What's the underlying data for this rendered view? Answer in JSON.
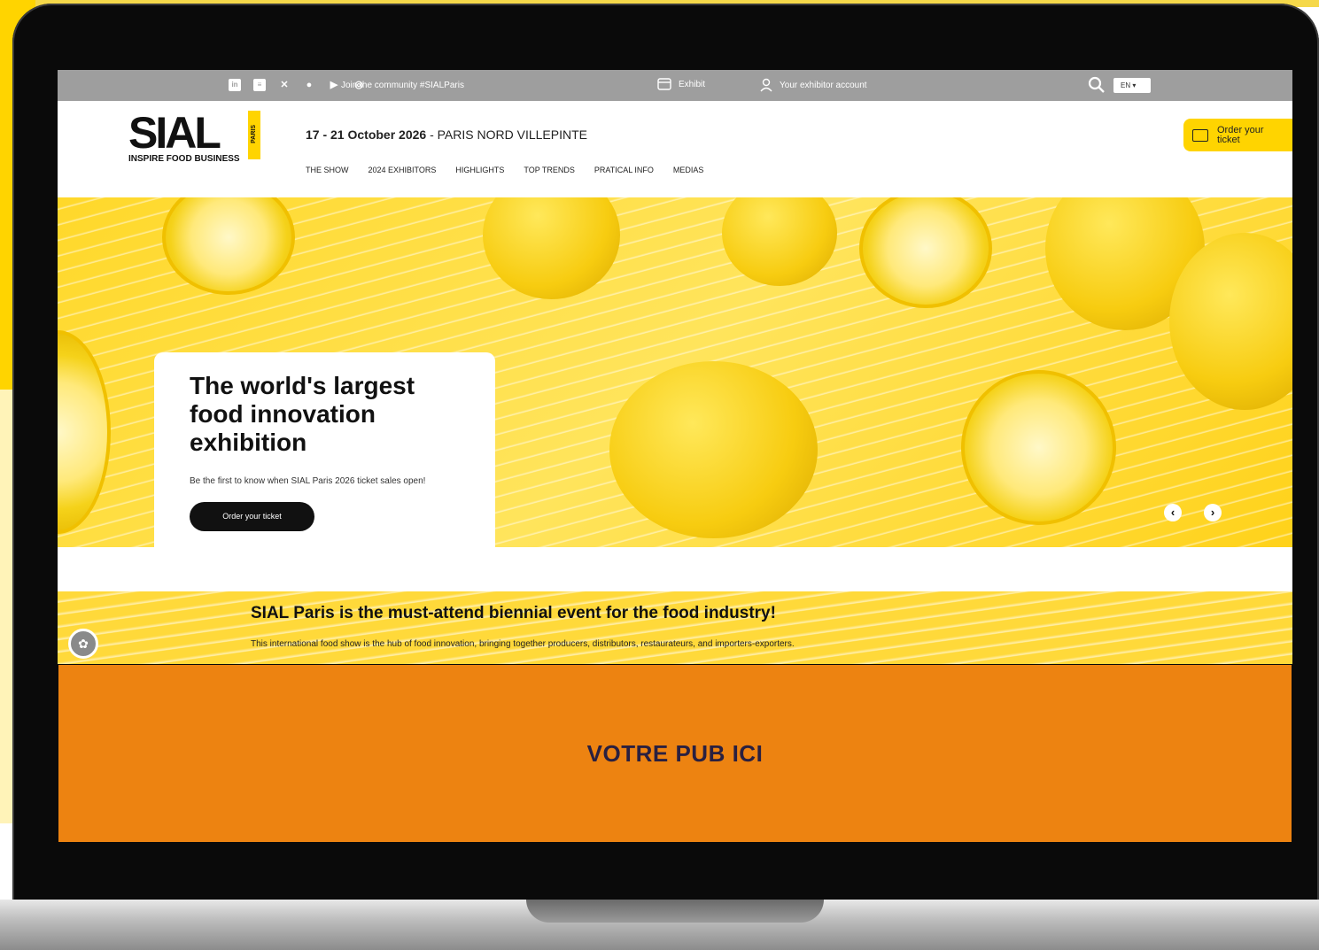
{
  "topbar": {
    "social_icons": [
      "linkedin-icon",
      "news-icon",
      "x-icon",
      "facebook-icon",
      "youtube-icon",
      "whatsapp-icon"
    ],
    "community": "Join the community #SIALParis",
    "exhibit": "Exhibit",
    "account": "Your exhibitor account",
    "lang": "EN"
  },
  "header": {
    "logo": "SIAL",
    "logo_city": "PARIS",
    "tagline": "INSPIRE FOOD BUSINESS",
    "dates": "17 - 21 October 2026",
    "venue": " - PARIS NORD VILLEPINTE",
    "nav": [
      "THE SHOW",
      "2024 EXHIBITORS",
      "HIGHLIGHTS",
      "TOP TRENDS",
      "PRATICAL INFO",
      "MEDIAS"
    ],
    "order_tab": "Order your ticket"
  },
  "hero": {
    "title": "The world's largest food innovation exhibition",
    "subtitle": "Be the first to know when SIAL Paris 2026 ticket sales open!",
    "button": "Order your ticket"
  },
  "banner": {
    "title": "SIAL Paris is the must-attend biennial event for the food industry!",
    "text": "This international food show is the hub of food innovation, bringing together producers, distributors, restaurateurs, and importers-exporters."
  },
  "ad": {
    "text": "VOTRE PUB ICI",
    "color": "#ed8311"
  },
  "colors": {
    "brand_yellow": "#ffd400",
    "topbar_gray": "#9e9e9e"
  }
}
